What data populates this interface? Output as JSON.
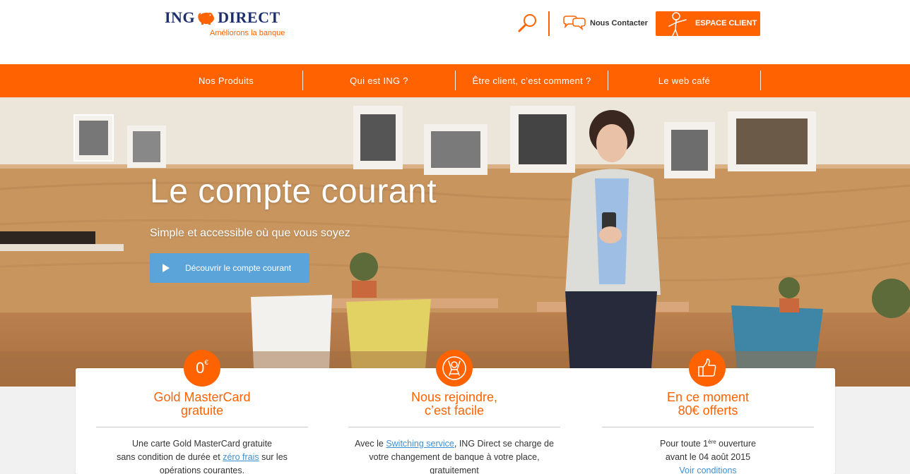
{
  "brand": {
    "name_left": "ING",
    "name_right": "DIRECT",
    "tagline": "Améliorons la banque",
    "colors": {
      "orange": "#ff6200",
      "navy": "#1e2f6e",
      "cta_blue": "#5ba4d9",
      "link_blue": "#3f8fd2"
    }
  },
  "header": {
    "search_icon": "search-icon",
    "contact_label": "Nous Contacter",
    "client_button_label": "ESPACE CLIENT"
  },
  "nav": {
    "items": [
      {
        "label": "Nos Produits"
      },
      {
        "label": "Qui est ING ?"
      },
      {
        "label": "Être client, c’est comment ?"
      },
      {
        "label": "Le web café"
      }
    ]
  },
  "hero": {
    "title": "Le compte courant",
    "subtitle": "Simple et accessible où que vous soyez",
    "cta_label": "Découvrir le compte courant"
  },
  "features": [
    {
      "badge_text": "0",
      "badge_sup": "€",
      "title_line1": "Gold MasterCard",
      "title_line2": "gratuite",
      "line1": "Une carte Gold MasterCard gratuite",
      "line2_before": "sans condition de durée et ",
      "line2_link": "zéro frais",
      "line2_after": " sur les",
      "line3": "opérations courantes."
    },
    {
      "badge_icon": "waving-person-icon",
      "title_line1": "Nous rejoindre,",
      "title_line2": "c’est facile",
      "line1_before": "Avec le ",
      "line1_link": "Switching service",
      "line1_after": ", ING Direct se charge de",
      "line2": "votre changement de banque à votre place,",
      "line3": "gratuitement"
    },
    {
      "badge_icon": "thumbs-up-icon",
      "title_line1": "En ce moment",
      "title_line2": "80€ offerts",
      "line1_before": "Pour toute 1",
      "line1_sup": "ère",
      "line1_after": " ouverture",
      "line2": "avant le 04 août 2015",
      "line3_link": "Voir conditions"
    }
  ]
}
